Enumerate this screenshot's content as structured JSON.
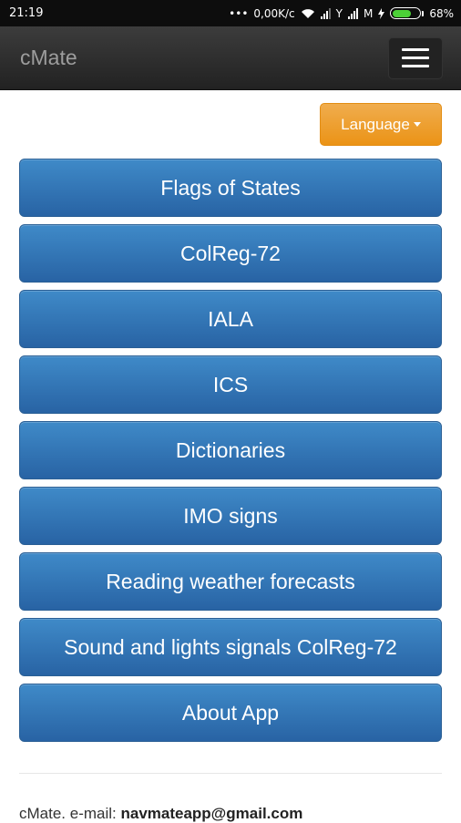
{
  "status_bar": {
    "time": "21:19",
    "dots": "•••",
    "net_speed": "0,00K/c",
    "carrier_label": "Y",
    "carrier_label_2": "M",
    "battery_percent": "68%",
    "battery_level": 0.68,
    "battery_color": "#4cd137"
  },
  "navbar": {
    "brand": "cMate",
    "menu_icon": "hamburger-icon"
  },
  "language": {
    "label": "Language",
    "color": "#f0ad4e"
  },
  "menu": {
    "items": [
      {
        "label": "Flags of States"
      },
      {
        "label": "ColReg-72"
      },
      {
        "label": "IALA"
      },
      {
        "label": "ICS"
      },
      {
        "label": "Dictionaries"
      },
      {
        "label": "IMO signs"
      },
      {
        "label": "Reading weather forecasts"
      },
      {
        "label": "Sound and lights signals ColReg-72"
      },
      {
        "label": "About App"
      }
    ],
    "button_color": "#337ab7"
  },
  "footer": {
    "prefix": "cMate. e-mail: ",
    "email": "navmateapp@gmail.com"
  }
}
